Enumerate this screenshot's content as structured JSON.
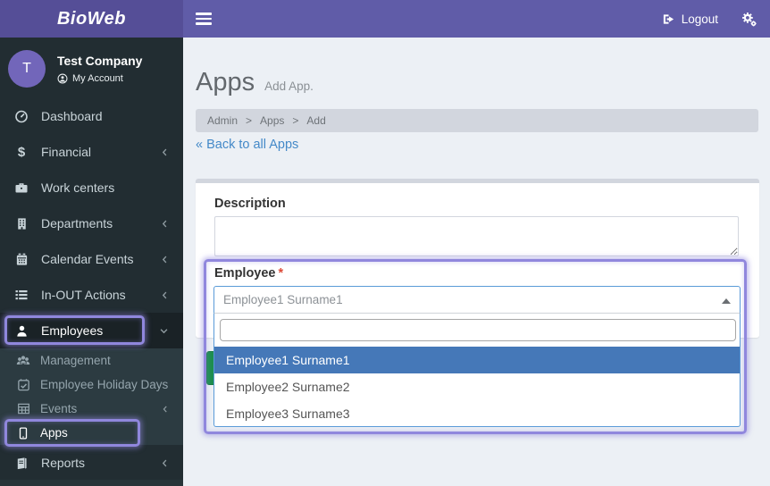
{
  "topbar": {
    "brand": "BioWeb",
    "logout_label": "Logout"
  },
  "user_panel": {
    "initial": "T",
    "company": "Test Company",
    "account_label": "My Account"
  },
  "sidebar": {
    "items": [
      {
        "label": "Dashboard"
      },
      {
        "label": "Financial"
      },
      {
        "label": "Work centers"
      },
      {
        "label": "Departments"
      },
      {
        "label": "Calendar Events"
      },
      {
        "label": "In-OUT Actions"
      },
      {
        "label": "Employees"
      },
      {
        "label": "Reports"
      }
    ],
    "employees_submenu": [
      {
        "label": "Management"
      },
      {
        "label": "Employee Holiday Days"
      },
      {
        "label": "Events"
      },
      {
        "label": "Apps"
      }
    ],
    "financial_icon_glyph": "$"
  },
  "page": {
    "title": "Apps",
    "subtitle": "Add App.",
    "breadcrumb": {
      "items": [
        "Admin",
        "Apps",
        "Add"
      ],
      "separator": ">"
    },
    "back_link": "« Back to all Apps"
  },
  "form": {
    "description_label": "Description",
    "description_value": "",
    "employee_label": "Employee",
    "required_marker": "*",
    "select_value": "Employee1 Surname1",
    "search_value": "",
    "options": [
      "Employee1 Surname1",
      "Employee2 Surname2",
      "Employee3 Surname3"
    ],
    "selected_option_index": 0
  },
  "colors": {
    "topbar": "#605ca8",
    "logo_bg": "#554e97",
    "sidebar_bg": "#222d32",
    "submenu_bg": "#2c3b41",
    "active_item_bg": "#1a2226",
    "content_bg": "#ecf0f5",
    "breadcrumb_bg": "#d2d6de",
    "link_blue": "#4489c8",
    "selected_option_bg": "#4578b8",
    "highlight_annotation": "#9087dd",
    "save_button_green": "#1e8e50",
    "required_red": "#dd4b39"
  }
}
